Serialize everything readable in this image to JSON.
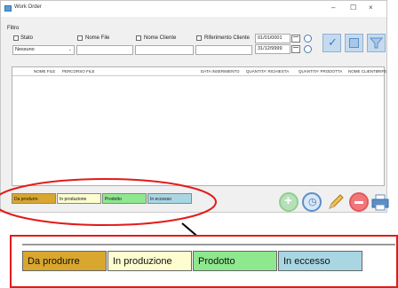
{
  "window": {
    "title": "Work Order",
    "minimize": "–",
    "maximize": "☐",
    "close": "×"
  },
  "filter": {
    "group_label": "Filtro",
    "stato_label": "Stato",
    "stato_value": "Nessuno",
    "nome_file_label": "Nome File",
    "nome_cliente_label": "Nome Cliente",
    "riferimento_label": "Riferimento Cliente",
    "date_from": "01/01/0001",
    "date_to": "31/12/9999"
  },
  "grid": {
    "columns": [
      "NOME FILE",
      "PERCORSO FILE",
      "DATA INSERIMENTO",
      "QUANTITA' RICHIESTA",
      "QUANTITA' PRODOTTA",
      "NOME CLIENTE",
      "RIFE"
    ]
  },
  "legend": [
    {
      "label": "Da produrre",
      "color": "#d9a62e"
    },
    {
      "label": "In produzione",
      "color": "#fdfdd0"
    },
    {
      "label": "Prodotto",
      "color": "#8ee88e"
    },
    {
      "label": "In eccesso",
      "color": "#a9d6e3"
    }
  ],
  "colors": {
    "annotation_red": "#e31b1b"
  }
}
